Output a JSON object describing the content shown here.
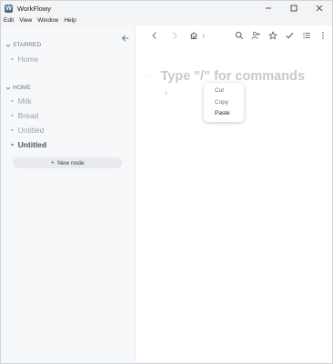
{
  "window": {
    "title": "WorkFlowy",
    "app_icon_glyph": "W"
  },
  "menubar": {
    "items": [
      "Edit",
      "View",
      "Window",
      "Help"
    ]
  },
  "sidebar": {
    "sections": [
      {
        "label": "STARRED",
        "items": [
          {
            "label": "Home",
            "active": false
          }
        ]
      },
      {
        "label": "HOME",
        "items": [
          {
            "label": "Milk",
            "active": false
          },
          {
            "label": "Bread",
            "active": false
          },
          {
            "label": "Untitled",
            "active": false
          },
          {
            "label": "Untitled",
            "active": true
          }
        ]
      }
    ],
    "new_node_label": "New node"
  },
  "toolbar": {
    "icons": [
      "back-arrow-icon",
      "forward-arrow-icon",
      "home-icon",
      "chevron-right-icon",
      "search-icon",
      "add-user-icon",
      "star-icon",
      "check-icon",
      "list-icon",
      "more-vertical-icon"
    ]
  },
  "document": {
    "title_placeholder": "Type \"/\" for commands",
    "handle_glyph": "···",
    "add_glyph": "+"
  },
  "context_menu": {
    "items": [
      {
        "label": "Cut",
        "enabled": false
      },
      {
        "label": "Copy",
        "enabled": false
      },
      {
        "label": "Paste",
        "enabled": true
      }
    ]
  },
  "colors": {
    "sidebar_bg": "#f7f8fa",
    "placeholder": "#c5cad0",
    "accent_icon": "#4f6b84"
  }
}
